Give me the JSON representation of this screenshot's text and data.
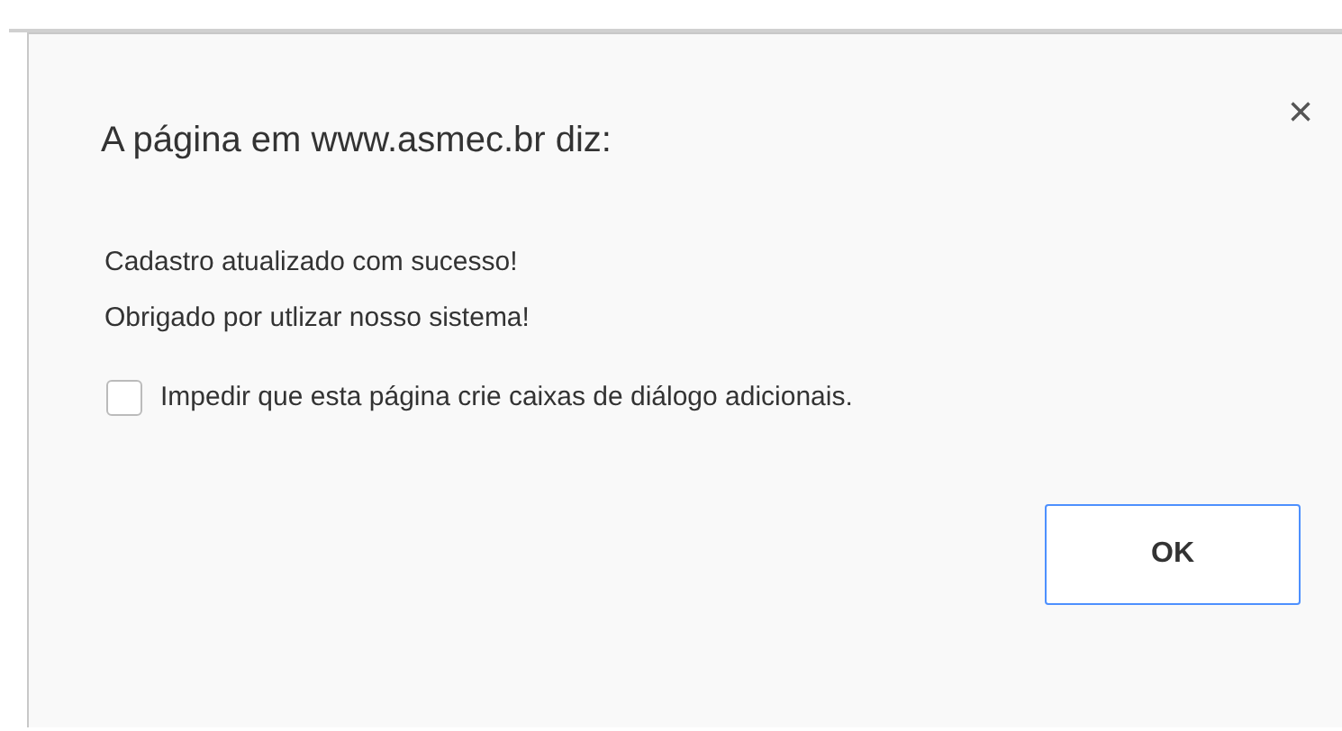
{
  "dialog": {
    "title": "A página em www.asmec.br diz:",
    "close": "×",
    "message": [
      "Cadastro atualizado com sucesso!",
      "Obrigado por utlizar nosso sistema!"
    ],
    "suppress": {
      "label": "Impedir que esta página crie caixas de diálogo adicionais.",
      "checked": false
    },
    "buttons": [
      "OK"
    ]
  }
}
